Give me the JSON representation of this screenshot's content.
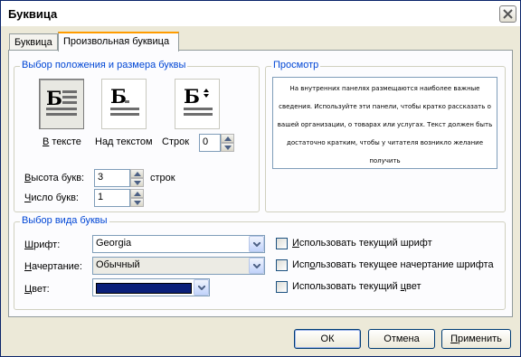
{
  "window": {
    "title": "Буквица"
  },
  "tabs": [
    {
      "label": "Буквица",
      "active": false
    },
    {
      "label": "Произвольная буквица",
      "active": true
    }
  ],
  "position_group": {
    "legend": "Выбор положения и размера буквы",
    "glyph": "Б",
    "buttons": [
      {
        "label_accel": "В",
        "label_rest": " тексте",
        "pressed": true
      },
      {
        "label": "Над текстом",
        "pressed": false
      },
      {
        "label": "Строк",
        "pressed": false
      }
    ],
    "lines_value": "0",
    "height_label_accel": "В",
    "height_label_rest": "ысота букв:",
    "height_value": "3",
    "height_unit": "строк",
    "count_label_accel": "Ч",
    "count_label_rest": "исло букв:",
    "count_value": "1"
  },
  "preview_group": {
    "legend": "Просмотр",
    "text": "На внутренних панелях размещаются наиболее важные сведения. Используйте эти панели, чтобы кратко рассказать о вашей организации, о товарах или услугах. Текст должен быть достаточно кратким, чтобы у читателя возникло желание получить"
  },
  "style_group": {
    "legend": "Выбор вида буквы",
    "font_label_accel": "Ш",
    "font_label_rest": "рифт:",
    "font_value": "Georgia",
    "style_label_accel": "Н",
    "style_label_rest": "ачертание:",
    "style_value": "Обычный",
    "color_label_accel": "Ц",
    "color_label_rest": "вет:",
    "color_value": "#0a1f7a",
    "checks": [
      {
        "pre": "",
        "accel": "И",
        "post": "спользовать текущий шрифт",
        "checked": false
      },
      {
        "pre": "Исп",
        "accel": "о",
        "post": "льзовать текущее начертание шрифта",
        "checked": false
      },
      {
        "pre": "Использовать текущий ",
        "accel": "ц",
        "post": "вет",
        "checked": false
      }
    ]
  },
  "footer": {
    "ok": "ОК",
    "cancel": "Отмена",
    "apply_accel": "П",
    "apply_rest": "рименить"
  },
  "icons": {
    "close": "close-icon",
    "dropdown": "chevron-down-icon",
    "spin_up": "arrow-up-icon",
    "spin_down": "arrow-down-icon"
  }
}
